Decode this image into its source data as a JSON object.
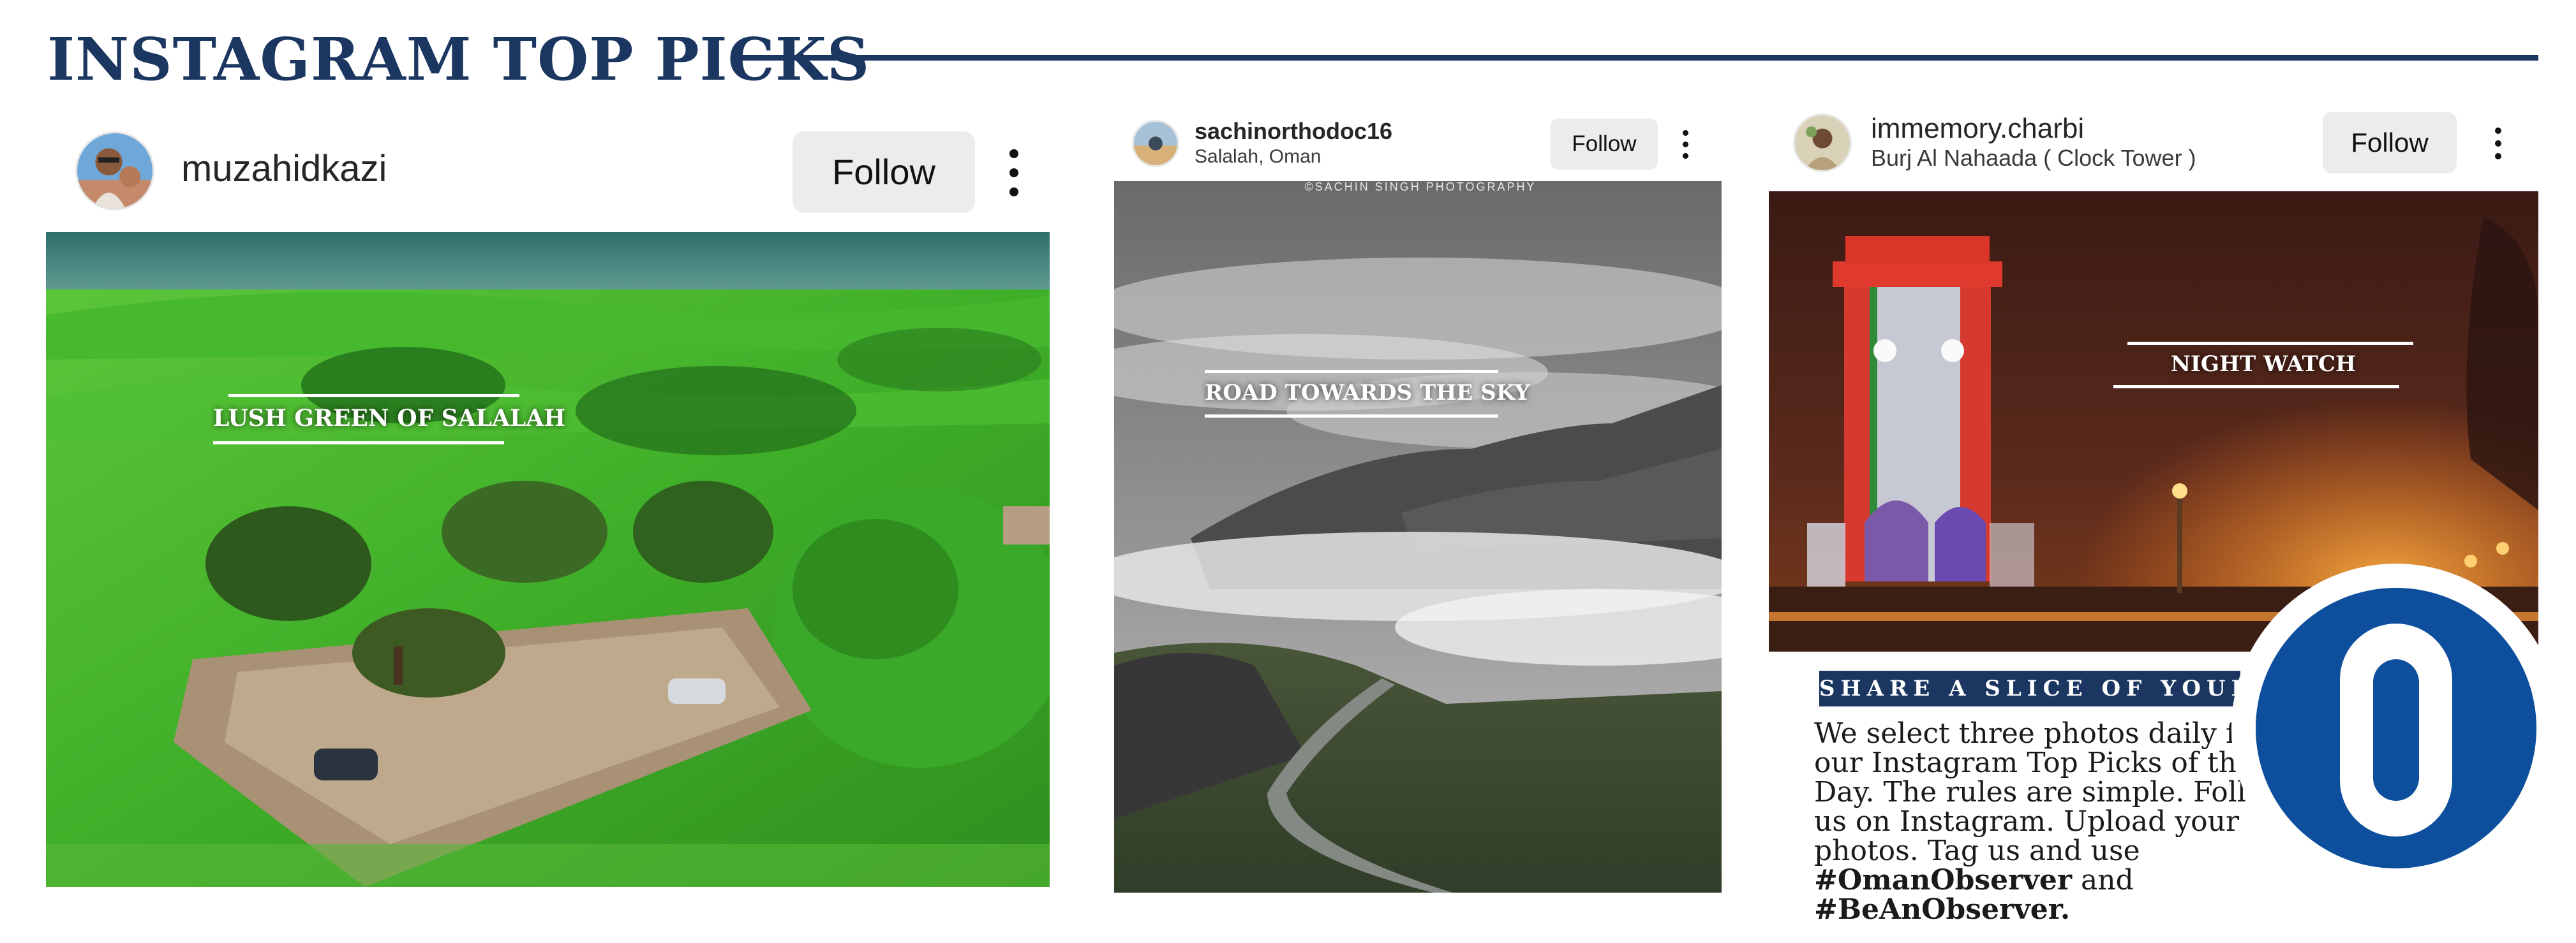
{
  "page": {
    "title": "INSTAGRAM TOP PICKS"
  },
  "colors": {
    "brand_navy": "#1b3660",
    "logo_blue": "#0d4f9c",
    "button_gray": "#ececec"
  },
  "posts": [
    {
      "username": "muzahidkazi",
      "location": "",
      "follow_label": "Follow",
      "more_icon": "more-vertical-icon",
      "caption": "LUSH GREEN OF SALALAH"
    },
    {
      "username": "sachinorthodoc16",
      "location": "Salalah, Oman",
      "follow_label": "Follow",
      "more_icon": "more-vertical-icon",
      "watermark": "©SACHIN SINGH PHOTOGRAPHY",
      "caption": "ROAD TOWARDS THE SKY"
    },
    {
      "username": "immemory.charbi",
      "location": "Burj Al Nahaada ( Clock Tower )",
      "follow_label": "Follow",
      "more_icon": "more-vertical-icon",
      "caption": "NIGHT WATCH"
    }
  ],
  "promo": {
    "banner": "SHARE A SLICE OF YOUR LIFE",
    "body": "We select three photos daily for our Instagram Top Picks of the Day. The rules are simple. Follow us on Instagram. Upload your photos. Tag us and use",
    "hashtag_1": "#OmanObserver",
    "connector": "and",
    "hashtag_2": "#BeAnObserver."
  },
  "logo": {
    "letter": "O"
  }
}
